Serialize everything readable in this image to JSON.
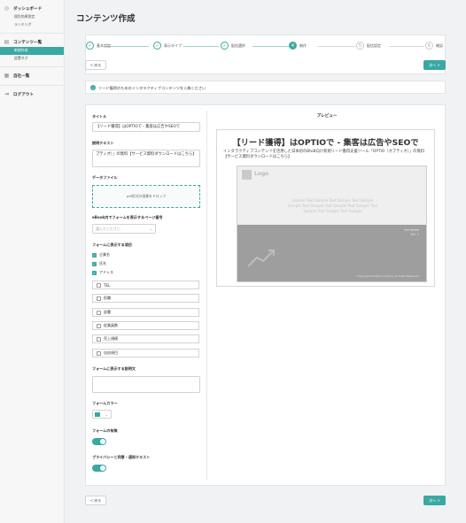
{
  "sidebar": {
    "groups": [
      {
        "label": "ダッシュボード",
        "icon": "dashboard-icon",
        "items": [
          {
            "label": "個別効果測定"
          },
          {
            "label": "ランキング"
          }
        ]
      },
      {
        "label": "コンテンツ一覧",
        "icon": "content-list-icon",
        "items": [
          {
            "label": "新規作成",
            "active": true
          },
          {
            "label": "設置タグ"
          }
        ]
      },
      {
        "label": "自社一覧",
        "icon": "company-icon",
        "items": []
      },
      {
        "label": "ログアウト",
        "icon": "logout-icon",
        "items": []
      }
    ]
  },
  "page": {
    "title": "コンテンツ作成"
  },
  "steps": [
    {
      "num": "✓",
      "label": "基本設定",
      "state": "done"
    },
    {
      "num": "✓",
      "label": "表示タイプ",
      "state": "done"
    },
    {
      "num": "✓",
      "label": "配信選択",
      "state": "done"
    },
    {
      "num": "4",
      "label": "制作",
      "state": "current"
    },
    {
      "num": "5",
      "label": "配信設定",
      "state": "todo"
    },
    {
      "num": "6",
      "label": "確認",
      "state": "todo"
    }
  ],
  "nav": {
    "back_label": "< 戻る",
    "next_label": "次へ >"
  },
  "info": {
    "text": "リード獲得のためのインタラクティブコンテンツを入稿ください"
  },
  "form": {
    "title_label": "タイトル",
    "title_value": "【リード獲得】はOPTIOで - 集客は広告やSEOで",
    "desc_label": "説明テキスト",
    "desc_value": "プティオ）」の無料【サービス資料ダウンロードはこちら】",
    "data_file_label": "データファイル",
    "dropzone_text": "pdf形式の画像をドロップ",
    "page_label": "eBook内でフォームを表示するページ番号",
    "page_placeholder": "選んでください",
    "fields_label": "フォームに表示する項目",
    "checked_fields": [
      "企業名",
      "氏名",
      "アドレス"
    ],
    "unchecked_fields": [
      "TEL",
      "役職",
      "部署",
      "従業員数",
      "売上規模",
      "自由項目"
    ],
    "form_desc_label": "フォームに表示する説明文",
    "form_color_label": "フォームカラー",
    "form_color": "#3aa8a3",
    "form_required_label": "フォームの有無",
    "privacy_label": "プライバシーと同意・通知テキスト"
  },
  "preview": {
    "label": "プレビュー",
    "heading": "【リード獲得】はOPTIOで - 集客は広告やSEOで",
    "description": "インタラクティブコンテンツを活用した日本初のBtoB向け新規リード獲得支援ツール「OPTIO（オプティオ）」の無料【サービス資料ダウンロードはこちら】",
    "image": {
      "logo_text": "Logo",
      "sample_lines": [
        "Sample Text Sample Text Sample Text Sample",
        "Sample Text Sample Text Sample Text Sample Text",
        "Sample Text Sample Text Sample"
      ],
      "meta_title": "the Name",
      "meta_vol": "Vol. 1",
      "copyright": "Copyright Sample Company All Right Reserved"
    }
  }
}
